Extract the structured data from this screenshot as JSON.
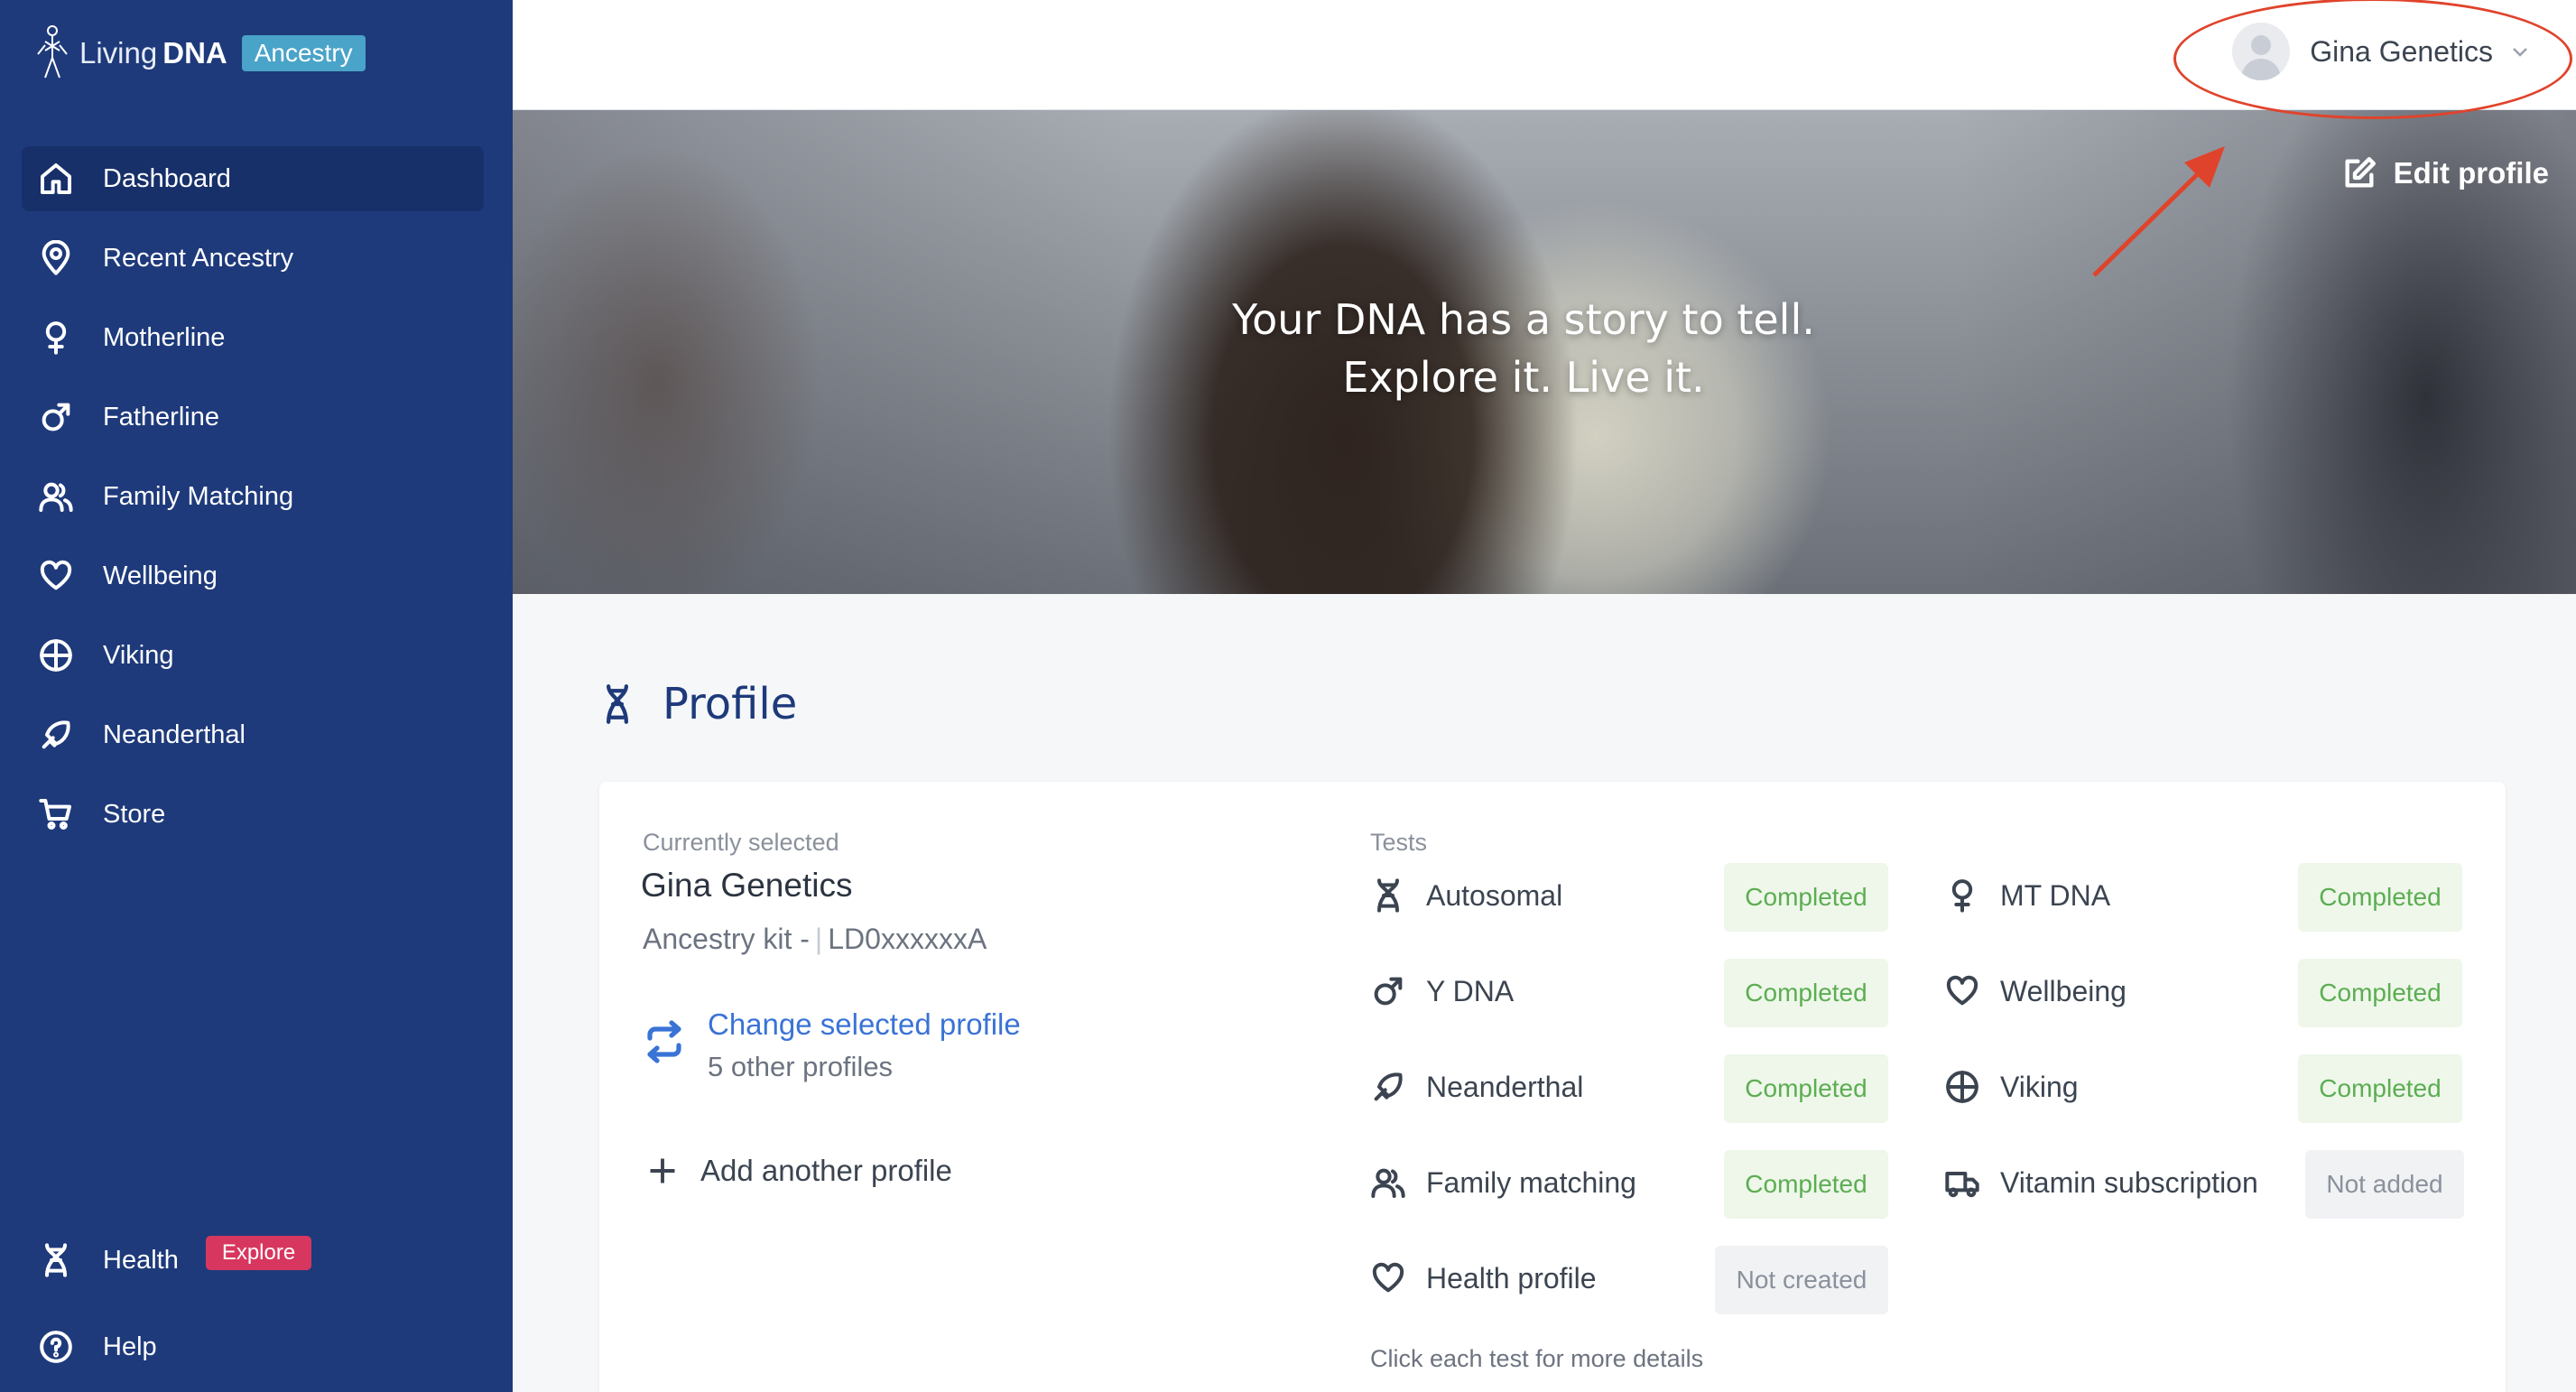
{
  "brand": {
    "name_light": "Living",
    "name_bold": "DNA",
    "badge": "Ancestry"
  },
  "sidebar": {
    "items": [
      {
        "label": "Dashboard",
        "icon": "home-icon",
        "active": true
      },
      {
        "label": "Recent Ancestry",
        "icon": "map-pin-icon"
      },
      {
        "label": "Motherline",
        "icon": "female-icon"
      },
      {
        "label": "Fatherline",
        "icon": "male-icon"
      },
      {
        "label": "Family Matching",
        "icon": "users-icon"
      },
      {
        "label": "Wellbeing",
        "icon": "heart-icon"
      },
      {
        "label": "Viking",
        "icon": "globe-icon"
      },
      {
        "label": "Neanderthal",
        "icon": "neanderthal-icon"
      },
      {
        "label": "Store",
        "icon": "cart-icon"
      }
    ],
    "health": {
      "label": "Health",
      "badge": "Explore",
      "icon": "dna-icon"
    },
    "help": {
      "label": "Help",
      "icon": "help-circle-icon"
    }
  },
  "topbar": {
    "user_name": "Gina Genetics"
  },
  "hero": {
    "line1": "Your DNA has a story to tell.",
    "line2": "Explore it. Live it.",
    "edit_label": "Edit profile"
  },
  "profile": {
    "title": "Profile",
    "currently_selected_label": "Currently selected",
    "name": "Gina Genetics",
    "kit_prefix": "Ancestry kit -",
    "kit_id": "LD0xxxxxxA",
    "change_label": "Change selected profile",
    "other_profiles": "5 other profiles",
    "add_label": "Add another profile",
    "tests_label": "Tests",
    "tests": [
      {
        "name": "Autosomal",
        "status": "Completed",
        "icon": "dna-icon"
      },
      {
        "name": "MT DNA",
        "status": "Completed",
        "icon": "female-icon"
      },
      {
        "name": "Y DNA",
        "status": "Completed",
        "icon": "male-icon"
      },
      {
        "name": "Wellbeing",
        "status": "Completed",
        "icon": "heart-icon"
      },
      {
        "name": "Neanderthal",
        "status": "Completed",
        "icon": "neanderthal-icon"
      },
      {
        "name": "Viking",
        "status": "Completed",
        "icon": "globe-icon"
      },
      {
        "name": "Family matching",
        "status": "Completed",
        "icon": "users-icon"
      },
      {
        "name": "Vitamin subscription",
        "status": "Not added",
        "icon": "truck-icon"
      },
      {
        "name": "Health profile",
        "status": "Not created",
        "icon": "heart-icon"
      }
    ],
    "hint": "Click each test for more details"
  },
  "colors": {
    "sidebar": "#1e3a7b",
    "link": "#3a73d6",
    "completed": "#5cad52",
    "explore_badge": "#d7375f",
    "annotation": "#e0432b"
  }
}
